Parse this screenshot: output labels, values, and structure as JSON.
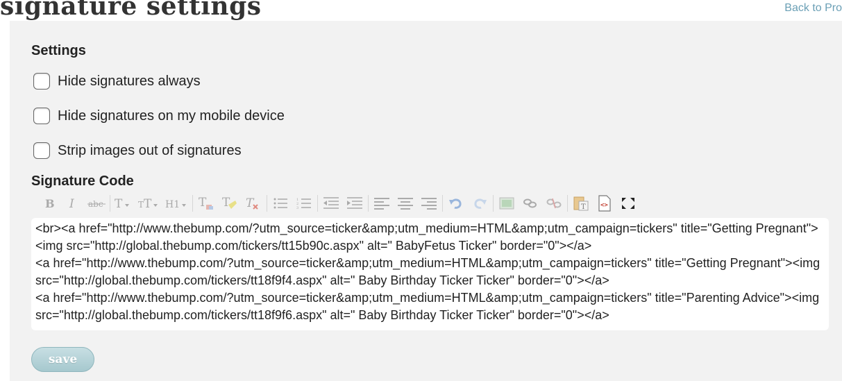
{
  "header": {
    "title": "signature settings",
    "back_link": "Back to Pro"
  },
  "settings": {
    "heading": "Settings",
    "options": [
      {
        "label": "Hide signatures always",
        "checked": false
      },
      {
        "label": "Hide signatures on my mobile device",
        "checked": false
      },
      {
        "label": "Strip images out of signatures",
        "checked": false
      }
    ]
  },
  "signature": {
    "heading": "Signature Code",
    "toolbar": [
      {
        "name": "bold-icon",
        "glyph": "B"
      },
      {
        "name": "italic-icon",
        "glyph": "I"
      },
      {
        "name": "strikethrough-icon",
        "glyph": "abc"
      },
      {
        "name": "font-size-icon",
        "glyph": "T▾"
      },
      {
        "name": "font-family-icon",
        "glyph": "тT▾"
      },
      {
        "name": "heading-icon",
        "glyph": "H1▾"
      },
      {
        "name": "text-color-icon",
        "glyph": "T"
      },
      {
        "name": "highlight-icon",
        "glyph": "T"
      },
      {
        "name": "clear-format-icon",
        "glyph": "T"
      },
      {
        "name": "bullet-list-icon",
        "glyph": "☰"
      },
      {
        "name": "numbered-list-icon",
        "glyph": "☰"
      },
      {
        "name": "outdent-icon",
        "glyph": "⇤"
      },
      {
        "name": "indent-icon",
        "glyph": "⇥"
      },
      {
        "name": "align-left-icon",
        "glyph": "≡"
      },
      {
        "name": "align-center-icon",
        "glyph": "≡"
      },
      {
        "name": "align-right-icon",
        "glyph": "≡"
      },
      {
        "name": "undo-icon",
        "glyph": "↶"
      },
      {
        "name": "redo-icon",
        "glyph": "↷"
      },
      {
        "name": "image-icon",
        "glyph": "▣"
      },
      {
        "name": "link-icon",
        "glyph": "∞"
      },
      {
        "name": "unlink-icon",
        "glyph": "∞"
      },
      {
        "name": "paste-text-icon",
        "glyph": "📋"
      },
      {
        "name": "source-code-icon",
        "glyph": "<>"
      },
      {
        "name": "fullscreen-icon",
        "glyph": "⛶"
      }
    ],
    "code": "<br><a href=\"http://www.thebump.com/?utm_source=ticker&amp;utm_medium=HTML&amp;utm_campaign=tickers\" title=\"Getting Pregnant\"><img src=\"http://global.thebump.com/tickers/tt15b90c.aspx\" alt=\" BabyFetus Ticker\" border=\"0\"></a>\n<a href=\"http://www.thebump.com/?utm_source=ticker&amp;utm_medium=HTML&amp;utm_campaign=tickers\" title=\"Getting Pregnant\"><img src=\"http://global.thebump.com/tickers/tt18f9f4.aspx\" alt=\" Baby Birthday Ticker Ticker\" border=\"0\"></a>\n<a href=\"http://www.thebump.com/?utm_source=ticker&amp;utm_medium=HTML&amp;utm_campaign=tickers\" title=\"Parenting Advice\"><img src=\"http://global.thebump.com/tickers/tt18f9f6.aspx\" alt=\" Baby Birthday Ticker Ticker\" border=\"0\"></a>"
  },
  "save_label": "save",
  "colors": {
    "link": "#6a9fb5",
    "panel_bg": "#f2f2f2",
    "save_button": "#a6c8ce"
  }
}
